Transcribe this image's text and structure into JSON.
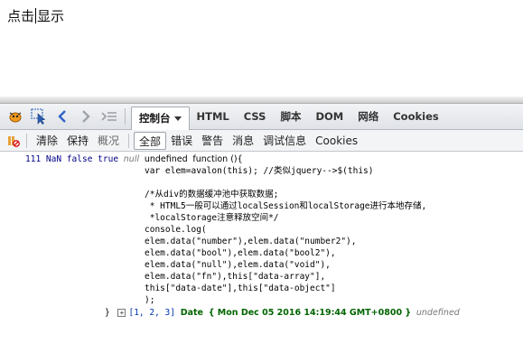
{
  "page": {
    "text_before": "点击",
    "text_after": "显示"
  },
  "toolbar": {
    "tabs": [
      {
        "label": "控制台"
      },
      {
        "label": "HTML"
      },
      {
        "label": "CSS"
      },
      {
        "label": "脚本"
      },
      {
        "label": "DOM"
      },
      {
        "label": "网络"
      },
      {
        "label": "Cookies"
      }
    ]
  },
  "subbar": {
    "clear": "清除",
    "persist": "保持",
    "profile": "概况",
    "filters": [
      {
        "label": "全部"
      },
      {
        "label": "错误"
      },
      {
        "label": "警告"
      },
      {
        "label": "消息"
      },
      {
        "label": "调试信息"
      },
      {
        "label": "Cookies"
      }
    ]
  },
  "console": {
    "values_head": [
      "111",
      "NaN",
      "false",
      "true",
      "null",
      "undefined"
    ],
    "function_lines": [
      "function (){",
      "var elem=avalon(this); //类似jquery-->$(this)",
      "",
      "/*从div的数据缓冲池中获取数据;",
      " * HTML5一般可以通过localSession和localStorage进行本地存储,",
      " *localStorage注意释放空间*/",
      "console.log(",
      "elem.data(\"number\"),elem.data(\"number2\"),",
      "elem.data(\"bool\"),elem.data(\"bool2\"),",
      "elem.data(\"null\"),elem.data(\"void\"),",
      "elem.data(\"fn\"),this[\"data-array\"],",
      "this[\"data-date\"],this[\"data-object\"]",
      ");"
    ],
    "tail": {
      "close_brace": "}",
      "array": "[1, 2, 3]",
      "date_label": "Date",
      "date_value": "{ Mon Dec 05 2016 14:19:44 GMT+0800 }",
      "last": "undefined"
    }
  }
}
